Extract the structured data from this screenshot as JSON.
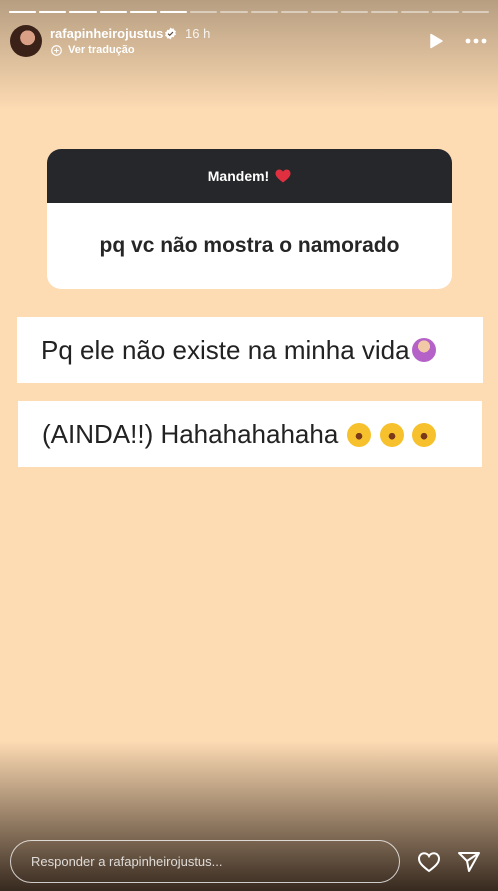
{
  "story": {
    "progress_total": 16,
    "progress_completed": 6,
    "background_color": "#fddbb3"
  },
  "header": {
    "username": "rafapinheirojustus",
    "time": "16 h",
    "translate": "Ver tradução",
    "icons": [
      "verified-badge-icon",
      "translate-icon",
      "play-icon",
      "more-icon"
    ]
  },
  "question": {
    "title": "Mandem! ❤️",
    "title_text": "Mandem!",
    "text": "pq vc não mostra o namorado"
  },
  "answers": [
    {
      "text": "Pq ele não existe na minha vida"
    },
    {
      "text": "(AINDA!!) Hahahahahaha"
    }
  ],
  "footer": {
    "reply_placeholder": "Responder a rafapinheirojustus...",
    "icons": [
      "heart-icon",
      "send-icon"
    ]
  }
}
